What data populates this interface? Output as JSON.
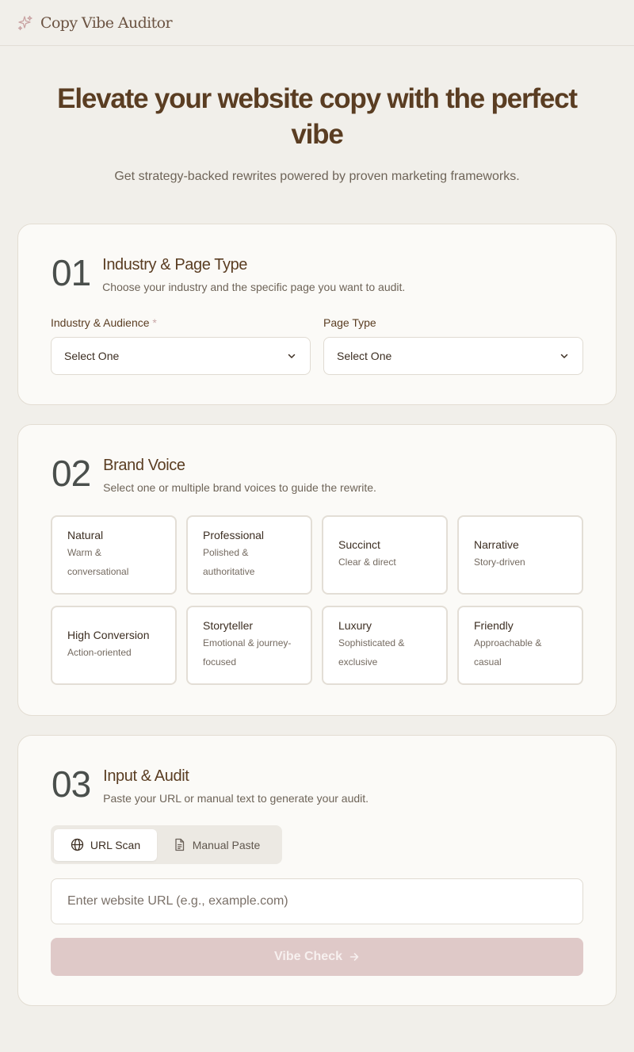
{
  "app": {
    "title": "Copy Vibe Auditor",
    "logo_icon": "sparkle-icon"
  },
  "hero": {
    "title": "Elevate your website copy with the perfect vibe",
    "subtitle": "Get strategy-backed rewrites powered by proven marketing frameworks."
  },
  "step1": {
    "number": "01",
    "title": "Industry & Page Type",
    "subtitle": "Choose your industry and the specific page you want to audit.",
    "industry_label": "Industry & Audience",
    "required_marker": "*",
    "industry_value": "Select One",
    "page_type_label": "Page Type",
    "page_type_value": "Select One"
  },
  "step2": {
    "number": "02",
    "title": "Brand Voice",
    "subtitle": "Select one or multiple brand voices to guide the rewrite.",
    "voices": [
      {
        "title": "Natural",
        "desc": "Warm & conversational"
      },
      {
        "title": "Professional",
        "desc": "Polished & authoritative"
      },
      {
        "title": "Succinct",
        "desc": "Clear & direct"
      },
      {
        "title": "Narrative",
        "desc": "Story-driven"
      },
      {
        "title": "High Conversion",
        "desc": "Action-oriented"
      },
      {
        "title": "Storyteller",
        "desc": "Emotional & journey-focused"
      },
      {
        "title": "Luxury",
        "desc": "Sophisticated & exclusive"
      },
      {
        "title": "Friendly",
        "desc": "Approachable & casual"
      }
    ]
  },
  "step3": {
    "number": "03",
    "title": "Input & Audit",
    "subtitle": "Paste your URL or manual text to generate your audit.",
    "tabs": [
      {
        "label": "URL Scan",
        "icon": "globe-icon",
        "active": true
      },
      {
        "label": "Manual Paste",
        "icon": "document-icon",
        "active": false
      }
    ],
    "url_placeholder": "Enter website URL (e.g., example.com)",
    "submit_label": "Vibe Check"
  },
  "colors": {
    "background": "#f1efea",
    "card": "#fbfaf7",
    "heading": "#5a3d22",
    "accent_button": "#dfc9c8"
  }
}
